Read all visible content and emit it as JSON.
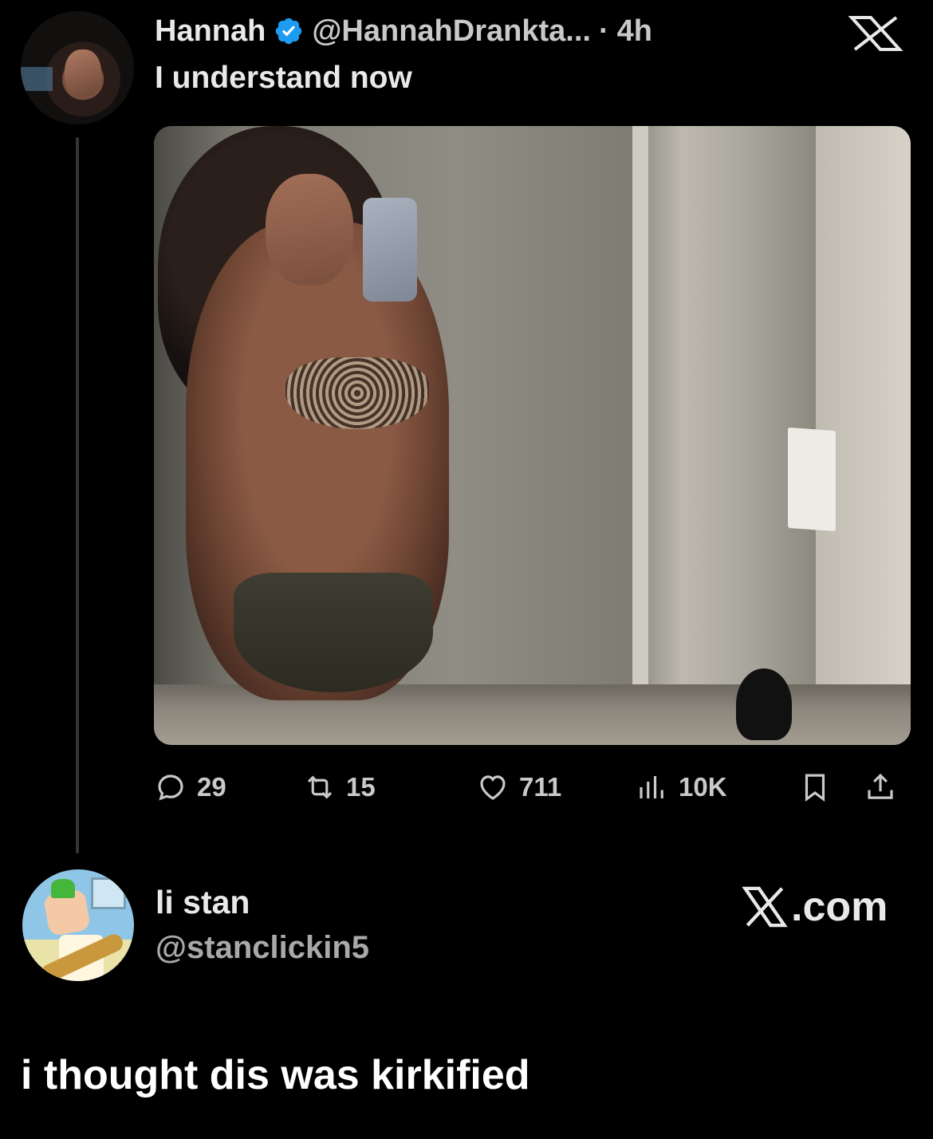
{
  "tweet": {
    "display_name": "Hannah",
    "handle": "@HannahDrankta...",
    "separator": "·",
    "time": "4h",
    "text": "I understand now",
    "avatar_icon": "profile-photo",
    "verified_icon": "verified-badge-icon",
    "verified_color": "#1d9bf0",
    "stats": {
      "replies": "29",
      "retweets": "15",
      "likes": "711",
      "views": "10K"
    }
  },
  "reply": {
    "display_name": "li stan",
    "handle": "@stanclickin5",
    "avatar_icon": "cartoon-avatar"
  },
  "branding": {
    "logo_icon": "x-logo-icon",
    "site": ".com"
  },
  "caption": "i thought dis was kirkified",
  "colors": {
    "background": "#000000",
    "text_primary": "#e7e9ea",
    "text_secondary": "#a9a9a9",
    "thread_line": "#333639"
  }
}
